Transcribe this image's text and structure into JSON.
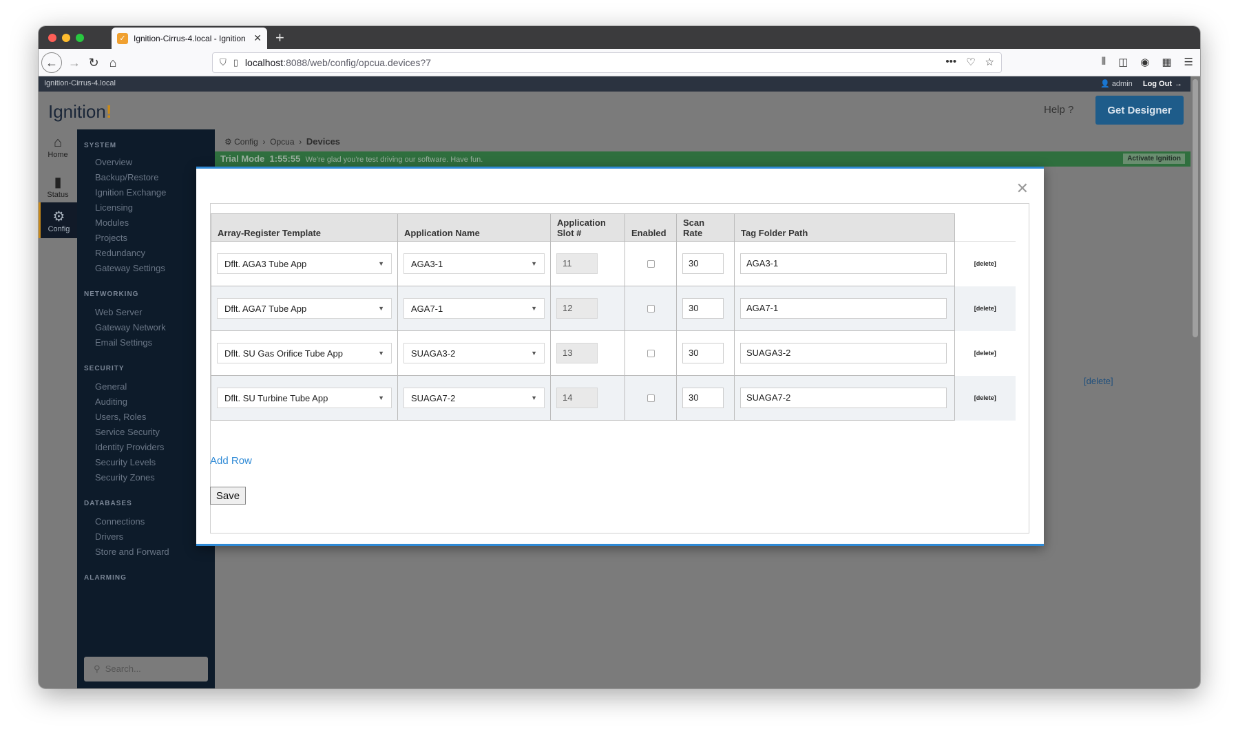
{
  "browser": {
    "tab_title": "Ignition-Cirrus-4.local - Ignition",
    "url_host": "localhost",
    "url_rest": ":8088/web/config/opcua.devices?7"
  },
  "app": {
    "gateway_name": "Ignition-Cirrus-4.local",
    "user": "admin",
    "logout": "Log Out",
    "logo_text": "Ignition",
    "logo_mark": "!",
    "help": "Help",
    "get_designer": "Get Designer"
  },
  "rail": {
    "home": "Home",
    "status": "Status",
    "config": "Config"
  },
  "sidebar": {
    "system_title": "SYSTEM",
    "system_items": [
      "Overview",
      "Backup/Restore",
      "Ignition Exchange",
      "Licensing",
      "Modules",
      "Projects",
      "Redundancy",
      "Gateway Settings"
    ],
    "networking_title": "NETWORKING",
    "networking_items": [
      "Web Server",
      "Gateway Network",
      "Email Settings"
    ],
    "security_title": "SECURITY",
    "security_items": [
      "General",
      "Auditing",
      "Users, Roles",
      "Service Security",
      "Identity Providers",
      "Security Levels",
      "Security Zones"
    ],
    "databases_title": "DATABASES",
    "databases_items": [
      "Connections",
      "Drivers",
      "Store and Forward"
    ],
    "alarming_title": "ALARMING",
    "search_placeholder": "Search..."
  },
  "breadcrumb": {
    "config": "Config",
    "opcua": "Opcua",
    "devices": "Devices"
  },
  "trial": {
    "label": "Trial Mode",
    "timer": "1:55:55",
    "message": "We're glad you're test driving our software. Have fun.",
    "activate": "Activate Ignition"
  },
  "background": {
    "delete_link": "[delete]"
  },
  "modal": {
    "headers": {
      "template": "Array-Register Template",
      "app_name": "Application Name",
      "slot_line1": "Application",
      "slot_line2": "Slot #",
      "enabled": "Enabled",
      "scan_line1": "Scan",
      "scan_line2": "Rate",
      "tag_path": "Tag Folder Path"
    },
    "rows": [
      {
        "template": "Dflt. AGA3 Tube App",
        "app_name": "AGA3-1",
        "slot": "11",
        "scan_rate": "30",
        "tag_path": "AGA3-1",
        "delete": "[delete]"
      },
      {
        "template": "Dflt. AGA7 Tube App",
        "app_name": "AGA7-1",
        "slot": "12",
        "scan_rate": "30",
        "tag_path": "AGA7-1",
        "delete": "[delete]"
      },
      {
        "template": "Dflt. SU Gas Orifice Tube App",
        "app_name": "SUAGA3-2",
        "slot": "13",
        "scan_rate": "30",
        "tag_path": "SUAGA3-2",
        "delete": "[delete]"
      },
      {
        "template": "Dflt. SU Turbine Tube App",
        "app_name": "SUAGA7-2",
        "slot": "14",
        "scan_rate": "30",
        "tag_path": "SUAGA7-2",
        "delete": "[delete]"
      }
    ],
    "add_row": "Add Row",
    "save": "Save"
  }
}
